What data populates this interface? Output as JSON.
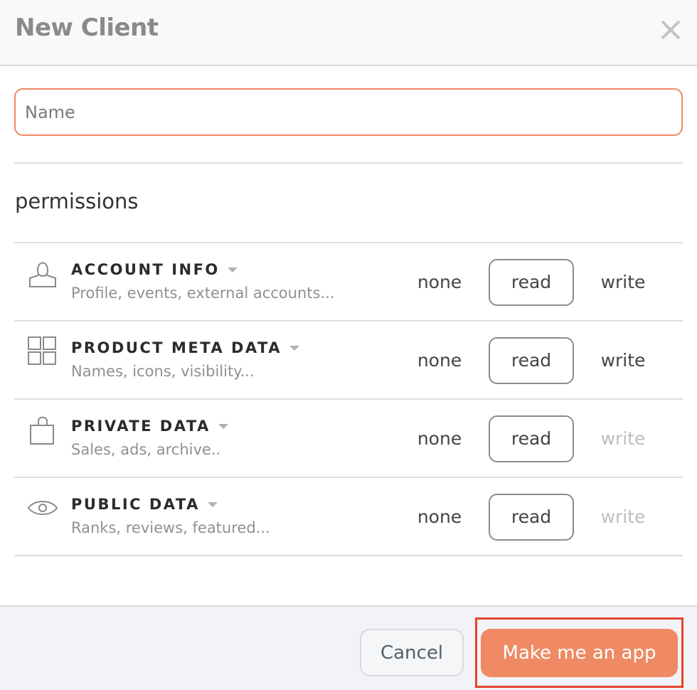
{
  "dialog": {
    "title": "New Client",
    "close_icon": "close-icon"
  },
  "name_field": {
    "placeholder": "Name",
    "value": ""
  },
  "permissions": {
    "title": "permissions",
    "options": [
      "none",
      "read",
      "write"
    ],
    "rows": [
      {
        "icon": "user-icon",
        "name": "ACCOUNT INFO",
        "description": "Profile, events, external accounts...",
        "selected": "read",
        "write_enabled": true
      },
      {
        "icon": "grid-icon",
        "name": "PRODUCT META DATA",
        "description": "Names, icons, visibility...",
        "selected": "read",
        "write_enabled": true
      },
      {
        "icon": "lock-icon",
        "name": "PRIVATE DATA",
        "description": "Sales, ads, archive..",
        "selected": "read",
        "write_enabled": false
      },
      {
        "icon": "eye-icon",
        "name": "PUBLIC DATA",
        "description": "Ranks, reviews, featured...",
        "selected": "read",
        "write_enabled": false
      }
    ]
  },
  "footer": {
    "cancel_label": "Cancel",
    "submit_label": "Make me an app"
  },
  "colors": {
    "accent": "#ef8a64",
    "input_border": "#ee8a66",
    "highlight": "#e5432d",
    "disabled_text": "#bdbdbd"
  }
}
